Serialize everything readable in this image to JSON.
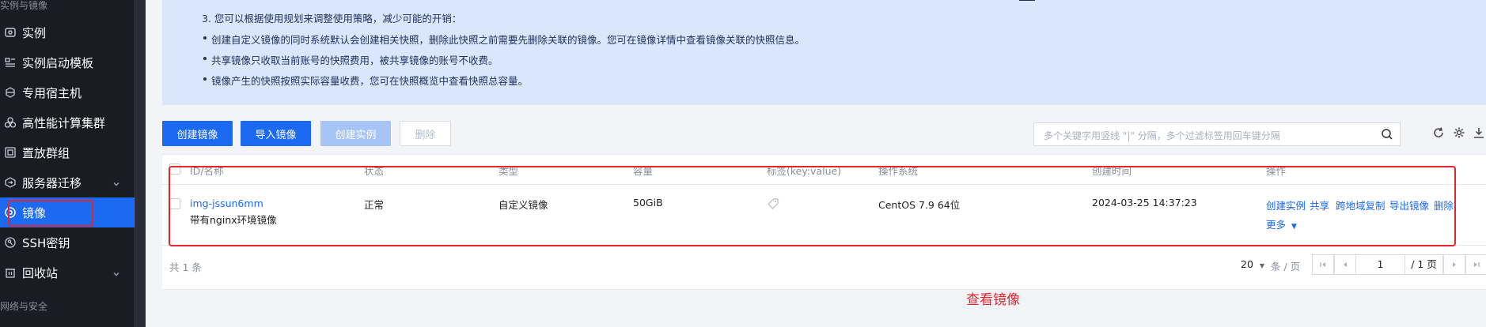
{
  "sidebar": {
    "groups": [
      "实例与镜像",
      "网络与安全"
    ],
    "items": [
      {
        "label": "实例",
        "icon": "server-icon",
        "active": false
      },
      {
        "label": "实例启动模板",
        "icon": "template-icon",
        "active": false
      },
      {
        "label": "专用宿主机",
        "icon": "host-icon",
        "active": false
      },
      {
        "label": "高性能计算集群",
        "icon": "cluster-icon",
        "active": false
      },
      {
        "label": "置放群组",
        "icon": "group-icon",
        "active": false
      },
      {
        "label": "服务器迁移",
        "icon": "migrate-icon",
        "active": false
      },
      {
        "label": "镜像",
        "icon": "image-icon",
        "active": true
      },
      {
        "label": "SSH密钥",
        "icon": "key-icon",
        "active": false
      },
      {
        "label": "回收站",
        "icon": "trash-icon",
        "active": false
      }
    ]
  },
  "notice": {
    "line3": "3. 您可以根据使用规划来调整使用策略，减少可能的开销：",
    "bullets": [
      "创建自定义镜像的同时系统默认会创建相关快照，删除此快照之前需要先删除关联的镜像。您可在镜像详情中查看镜像关联的快照信息。",
      "共享镜像只收取当前账号的快照费用，被共享镜像的账号不收费。",
      "镜像产生的快照按照实际容量收费，您可在快照概览中查看快照总容量。"
    ]
  },
  "toolbar": {
    "create_image": "创建镜像",
    "import_image": "导入镜像",
    "create_instance": "创建实例",
    "delete": "删除",
    "search_placeholder": "多个关键字用竖线 \"|\" 分隔，多个过滤标签用回车键分隔"
  },
  "table": {
    "columns": [
      "ID/名称",
      "状态",
      "类型",
      "容量",
      "标签(key:value)",
      "操作系统",
      "创建时间",
      "操作"
    ],
    "rows": [
      {
        "id": "img-jssun6mm",
        "name": "带有nginx环境镜像",
        "status": "正常",
        "type": "自定义镜像",
        "capacity": "50GiB",
        "os": "CentOS 7.9 64位",
        "created": "2024-03-25 14:37:23",
        "actions": [
          "创建实例",
          "共享",
          "跨地域复制",
          "导出镜像",
          "删除"
        ],
        "more": "更多"
      }
    ]
  },
  "pagination": {
    "total": "共 1 条",
    "page_size": "20",
    "page_size_unit": "条 / 页",
    "current_page": "1",
    "total_pages": "/ 1 页"
  },
  "annotation": "查看镜像",
  "colors": {
    "accent": "#1d6af2",
    "sidebar_bg": "#1a1c24",
    "notice_bg": "#dae6fc",
    "annotation_red": "#e3262c"
  }
}
